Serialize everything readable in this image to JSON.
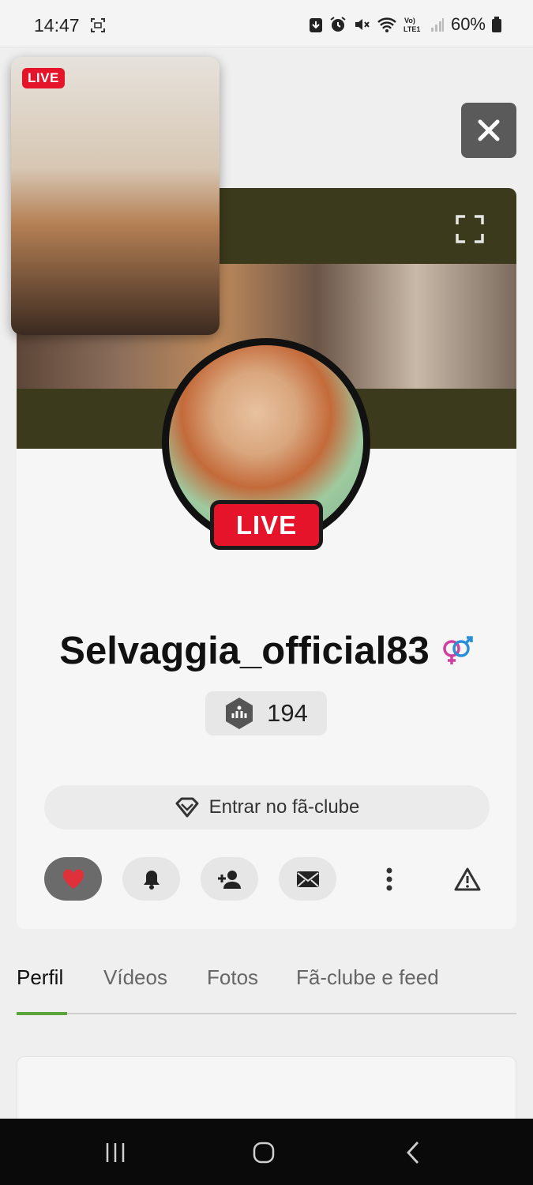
{
  "status_bar": {
    "time": "14:47",
    "battery": "60%",
    "icons": [
      "screenshot-icon",
      "download-icon",
      "alarm-icon",
      "mute-icon",
      "wifi-icon",
      "volte-icon",
      "signal-icon",
      "battery-icon"
    ]
  },
  "mini_player": {
    "live_label": "LIVE"
  },
  "profile": {
    "username": "Selvaggia_official83",
    "live_label": "LIVE",
    "level": "194",
    "gender_icon": "couple-gender-icon"
  },
  "fanclub_button": {
    "label": "Entrar no fã-clube",
    "icon": "diamond-icon"
  },
  "actions": [
    "heart-icon",
    "bell-icon",
    "add-user-icon",
    "mail-icon",
    "more-vert-icon",
    "warning-icon"
  ],
  "tabs": [
    {
      "label": "Perfil",
      "active": true
    },
    {
      "label": "Vídeos",
      "active": false
    },
    {
      "label": "Fotos",
      "active": false
    },
    {
      "label": "Fã-clube e feed",
      "active": false
    }
  ],
  "colors": {
    "live_red": "#e5142a",
    "tab_accent": "#5aa53a",
    "heart": "#e0303a"
  }
}
